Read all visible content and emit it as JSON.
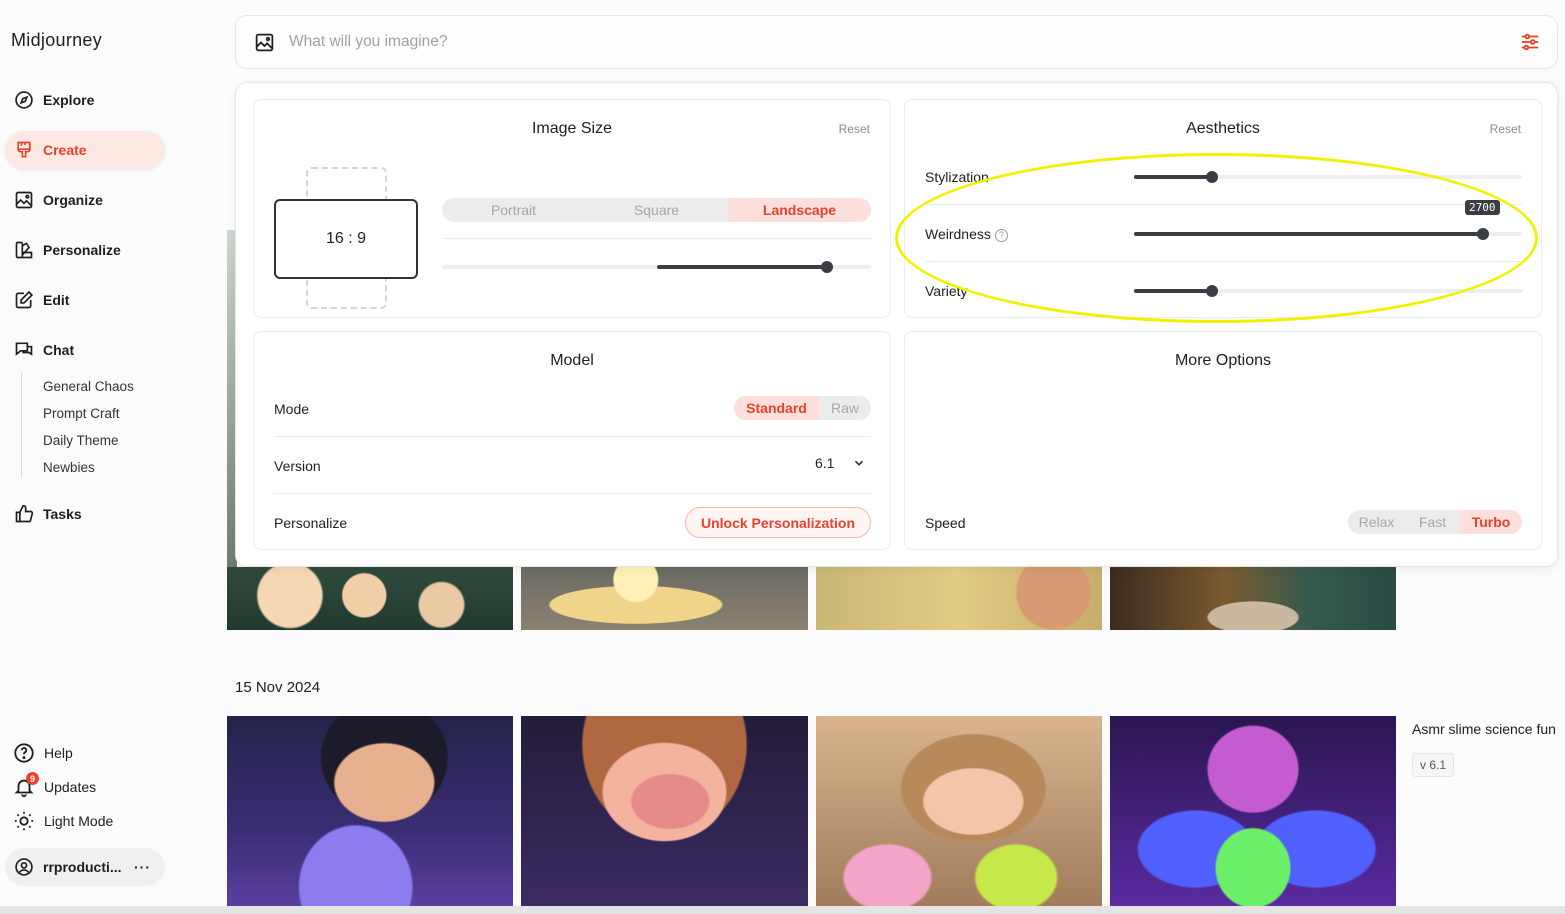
{
  "app": {
    "name": "Midjourney"
  },
  "sidebar": {
    "nav": [
      {
        "id": "explore",
        "label": "Explore",
        "icon": "compass-icon"
      },
      {
        "id": "create",
        "label": "Create",
        "icon": "brush-icon",
        "active": true
      },
      {
        "id": "organize",
        "label": "Organize",
        "icon": "image-icon"
      },
      {
        "id": "personalize",
        "label": "Personalize",
        "icon": "palette-icon"
      },
      {
        "id": "edit",
        "label": "Edit",
        "icon": "pencil-icon"
      },
      {
        "id": "chat",
        "label": "Chat",
        "icon": "chat-icon"
      }
    ],
    "chat_rooms": [
      "General Chaos",
      "Prompt Craft",
      "Daily Theme",
      "Newbies"
    ],
    "tasks": {
      "label": "Tasks",
      "icon": "thumbs-up-icon"
    },
    "bottom": {
      "help": "Help",
      "updates": "Updates",
      "updates_badge": "9",
      "light_mode": "Light Mode"
    },
    "user": {
      "name": "rrproducti...",
      "menu": "···"
    }
  },
  "search": {
    "placeholder": "What will you imagine?"
  },
  "settings_panel": {
    "image_size": {
      "title": "Image Size",
      "reset": "Reset",
      "ratio": "16 : 9",
      "orientation": {
        "options": [
          "Portrait",
          "Square",
          "Landscape"
        ],
        "selected": "Landscape"
      },
      "size_slider_fraction": 0.9
    },
    "aesthetics": {
      "title": "Aesthetics",
      "reset": "Reset",
      "stylization": {
        "label": "Stylization",
        "fraction": 0.2
      },
      "weirdness": {
        "label": "Weirdness",
        "fraction": 0.9,
        "tooltip": "2700",
        "help": "?"
      },
      "variety": {
        "label": "Variety",
        "fraction": 0.2
      }
    },
    "model": {
      "title": "Model",
      "mode": {
        "label": "Mode",
        "options": [
          "Standard",
          "Raw"
        ],
        "selected": "Standard"
      },
      "version": {
        "label": "Version",
        "value": "6.1"
      },
      "personalize": {
        "label": "Personalize",
        "button": "Unlock Personalization"
      }
    },
    "more_options": {
      "title": "More Options",
      "speed": {
        "label": "Speed",
        "options": [
          "Relax",
          "Fast",
          "Turbo"
        ],
        "selected": "Turbo"
      }
    }
  },
  "gallery": {
    "date": "15 Nov 2024",
    "caption": "Asmr slime science fun",
    "version": "v 6.1"
  },
  "colors": {
    "accent": "#e8422d",
    "accent_bg": "#fde0db",
    "highlight": "#f2f200"
  }
}
